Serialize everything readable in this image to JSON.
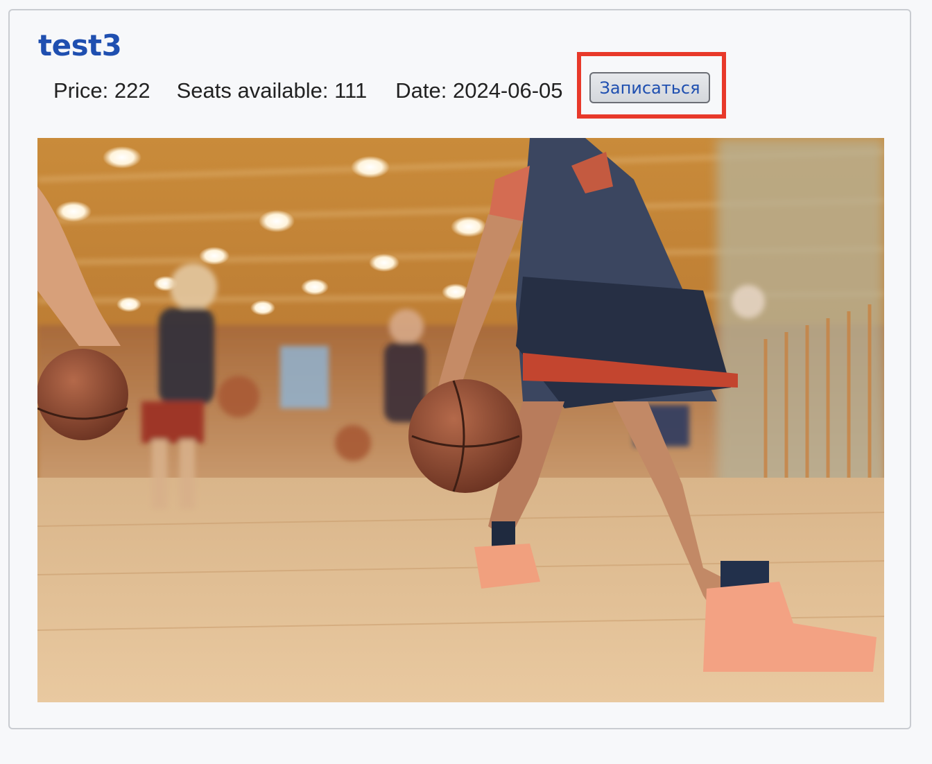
{
  "course": {
    "title": "test3",
    "price_label": "Price:",
    "price_value": "222",
    "seats_label": "Seats available:",
    "seats_value": "111",
    "date_label": "Date:",
    "date_value": "2024-06-05",
    "enroll_label": "Записаться"
  },
  "colors": {
    "title": "#1f4fb0",
    "highlight_border": "#e8392a",
    "button_text": "#1f4fb0"
  },
  "image": {
    "subject": "basketball-training-photo"
  }
}
